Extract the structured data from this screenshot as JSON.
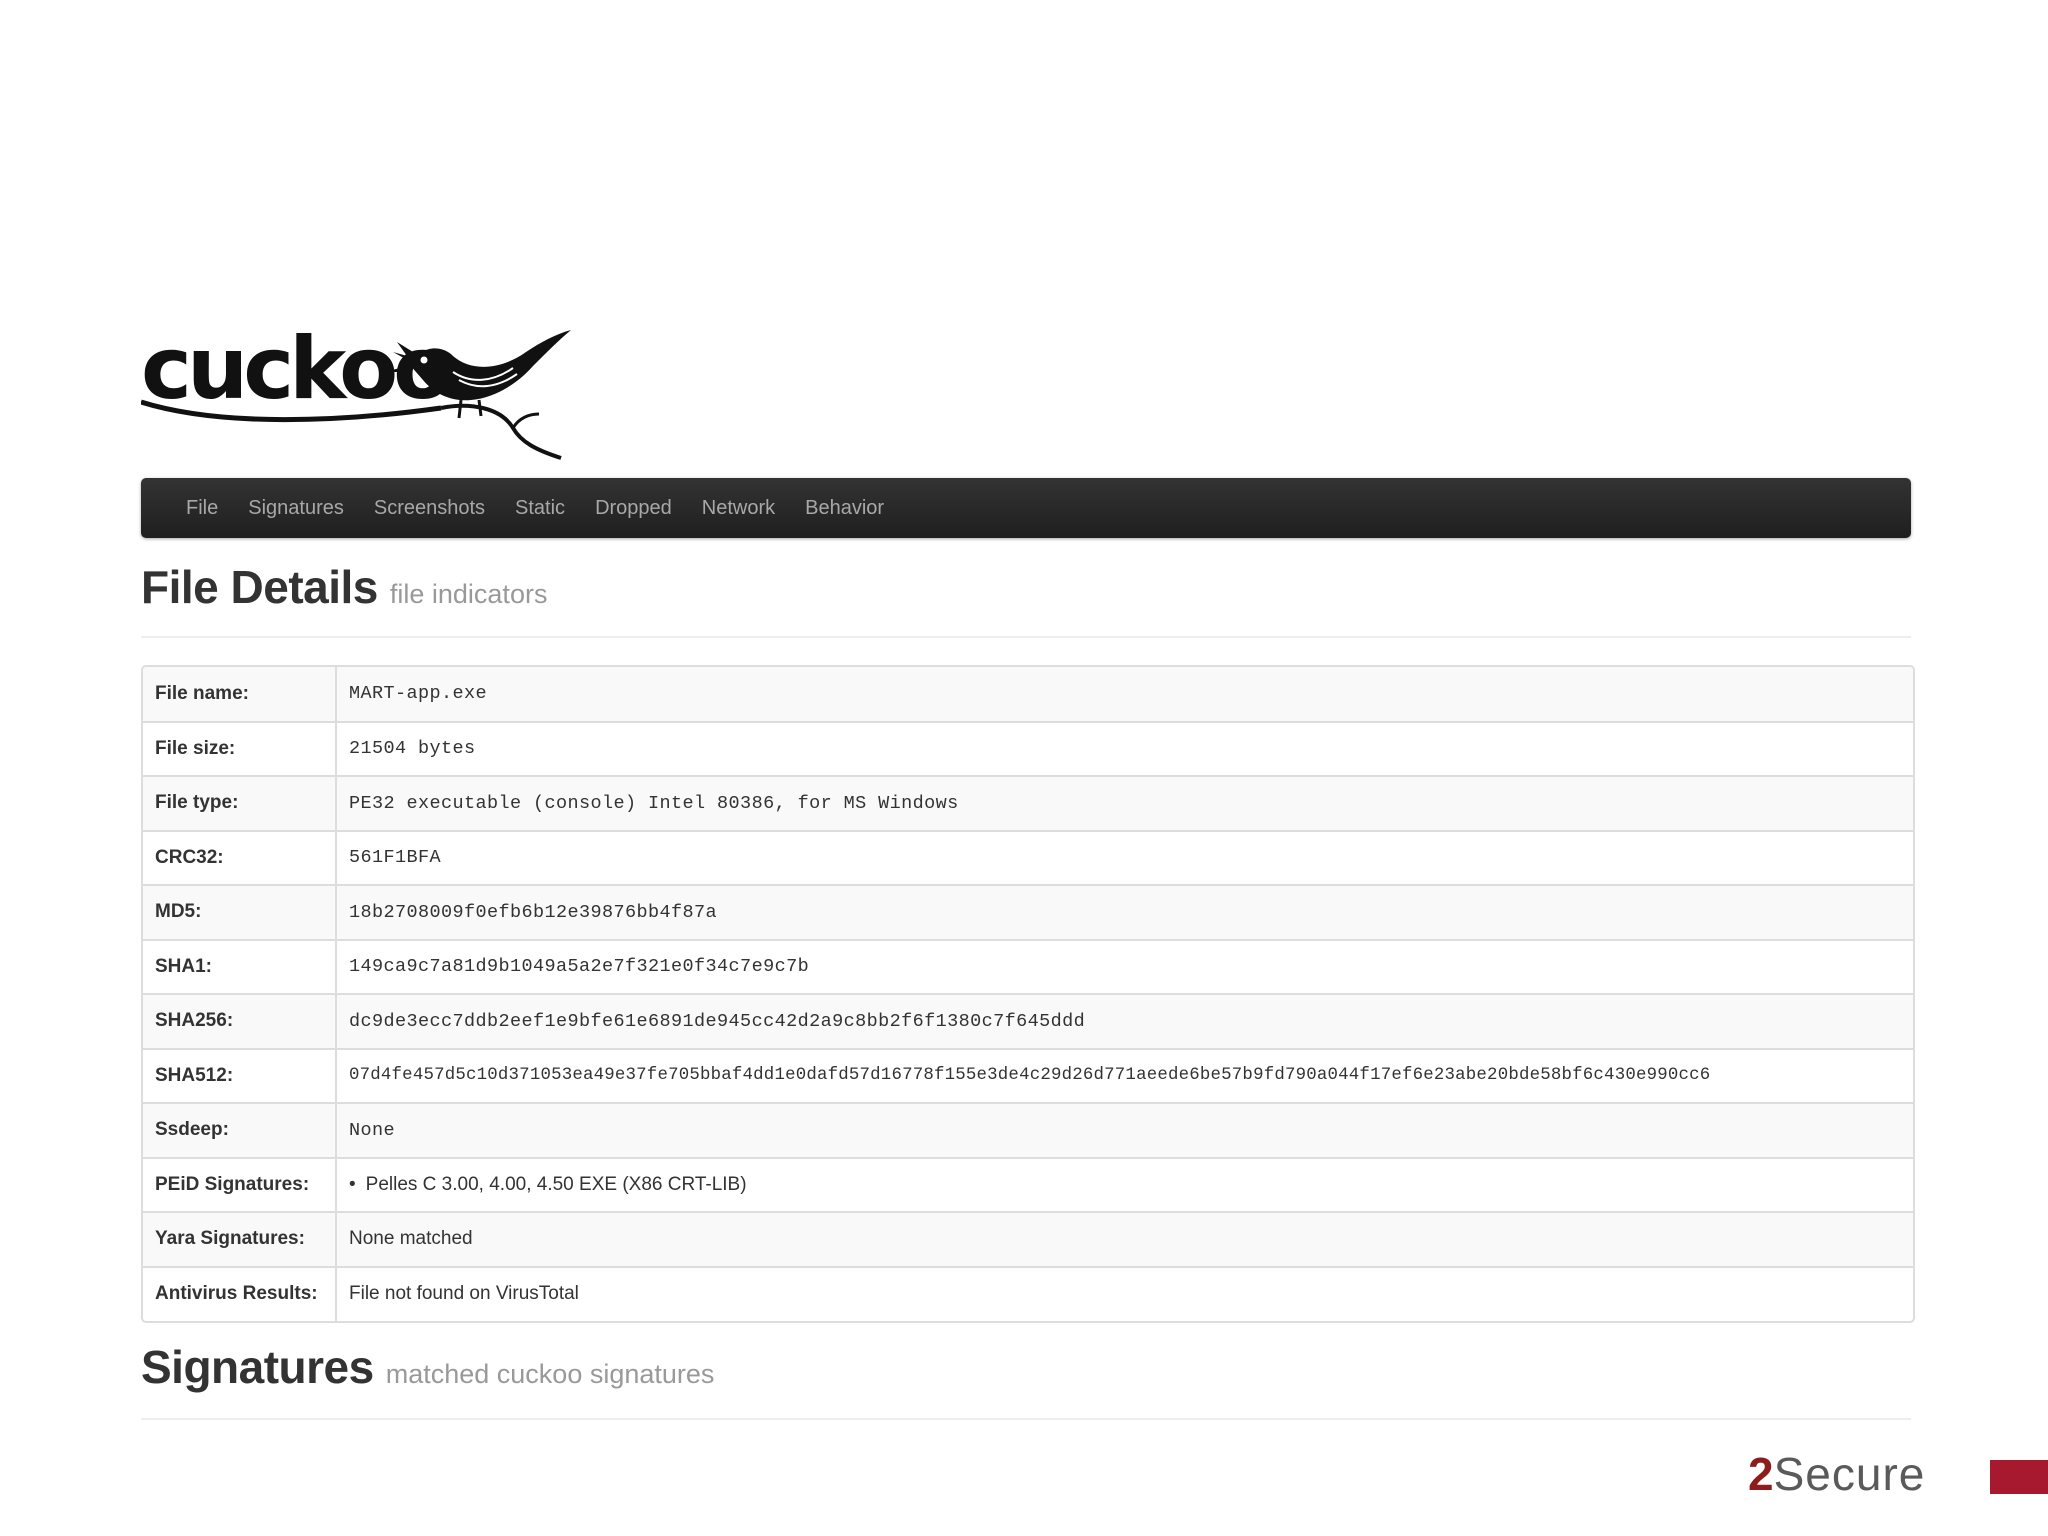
{
  "logo": {
    "text": "cuckoo",
    "icon": "cuckoo-bird-icon"
  },
  "nav": {
    "items": [
      "File",
      "Signatures",
      "Screenshots",
      "Static",
      "Dropped",
      "Network",
      "Behavior"
    ]
  },
  "file_details": {
    "title": "File Details",
    "subtitle": "file indicators",
    "rows": [
      {
        "key": "File name:",
        "value": "MART-app.exe"
      },
      {
        "key": "File size:",
        "value": "21504 bytes"
      },
      {
        "key": "File type:",
        "value": "PE32 executable (console) Intel 80386, for MS Windows"
      },
      {
        "key": "CRC32:",
        "value": "561F1BFA"
      },
      {
        "key": "MD5:",
        "value": "18b2708009f0efb6b12e39876bb4f87a"
      },
      {
        "key": "SHA1:",
        "value": "149ca9c7a81d9b1049a5a2e7f321e0f34c7e9c7b"
      },
      {
        "key": "SHA256:",
        "value": "dc9de3ecc7ddb2eef1e9bfe61e6891de945cc42d2a9c8bb2f6f1380c7f645ddd"
      },
      {
        "key": "SHA512:",
        "value": "07d4fe457d5c10d371053ea49e37fe705bbaf4dd1e0dafd57d16778f155e3de4c29d26d771aeede6be57b9fd790a044f17ef6e23abe20bde58bf6c430e990cc6"
      },
      {
        "key": "Ssdeep:",
        "value": "None"
      },
      {
        "key": "PEiD Signatures:",
        "value": "Pelles C 3.00, 4.00, 4.50 EXE (X86 CRT-LIB)"
      },
      {
        "key": "Yara Signatures:",
        "value": "None matched"
      },
      {
        "key": "Antivirus Results:",
        "value": "File not found on VirusTotal"
      }
    ]
  },
  "signatures": {
    "title": "Signatures",
    "subtitle": "matched cuckoo signatures"
  },
  "brand": {
    "two": "2",
    "word": "Secure",
    "accent_color": "#a6192e"
  }
}
